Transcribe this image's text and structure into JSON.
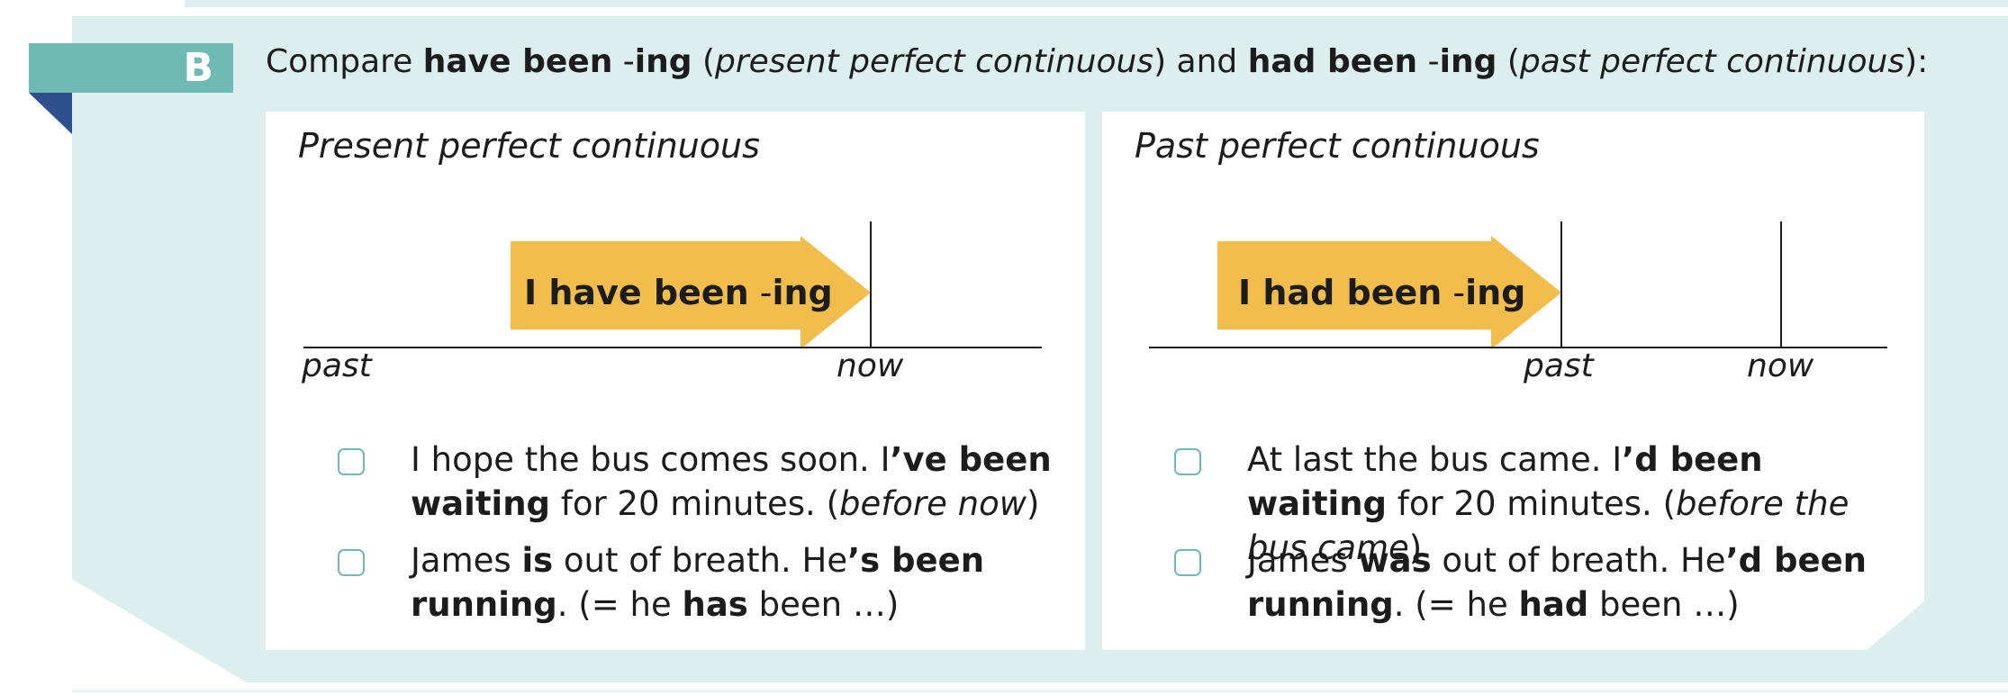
{
  "section": {
    "letter": "B",
    "heading": {
      "compare": "Compare ",
      "form1": "have been",
      "form1_dash": " -",
      "form1_ing": "ing",
      "paren_open1": " (",
      "tense1": "present perfect continuous",
      "paren_close_and": ") and ",
      "form2": "had been",
      "form2_dash": " -",
      "form2_ing": "ing",
      "paren_open2": " (",
      "tense2": "past perfect continuous",
      "paren_close_colon": "):"
    }
  },
  "left_panel": {
    "title": "Present perfect continuous",
    "arrow_bold": "I have been",
    "arrow_dash": " -",
    "arrow_ing": "ing",
    "label_past": "past",
    "label_now": "now",
    "examples": [
      {
        "s1": "I hope the bus comes soon.  I",
        "b1": "’ve been waiting",
        "s2": " for 20 minutes.  (",
        "note": "before now",
        "s3": ")"
      },
      {
        "s1": "James ",
        "b1": "is",
        "s2": " out of breath.  He",
        "b2": "’s been running",
        "s3": ".  (= he ",
        "b3": "has",
        "s4": " been …)"
      }
    ]
  },
  "right_panel": {
    "title": "Past perfect continuous",
    "arrow_bold": "I had been",
    "arrow_dash": " -",
    "arrow_ing": "ing",
    "label_past": "past",
    "label_now": "now",
    "examples": [
      {
        "s1": "At last the bus came.  I",
        "b1": "’d been waiting",
        "s2": " for 20 minutes.  (",
        "note": "before the bus came",
        "s3": ")"
      },
      {
        "s1": "James ",
        "b1": "was",
        "s2": " out of breath.  He",
        "b2": "’d been running",
        "s3": ".  (= he ",
        "b3": "had",
        "s4": " been …)"
      }
    ]
  },
  "colors": {
    "section_bg": "#ddeeee",
    "badge": "#6fbab5",
    "badge_tail": "#2d4f8c",
    "arrow": "#f2bd4b",
    "checkbox_border": "#6fbab5"
  }
}
